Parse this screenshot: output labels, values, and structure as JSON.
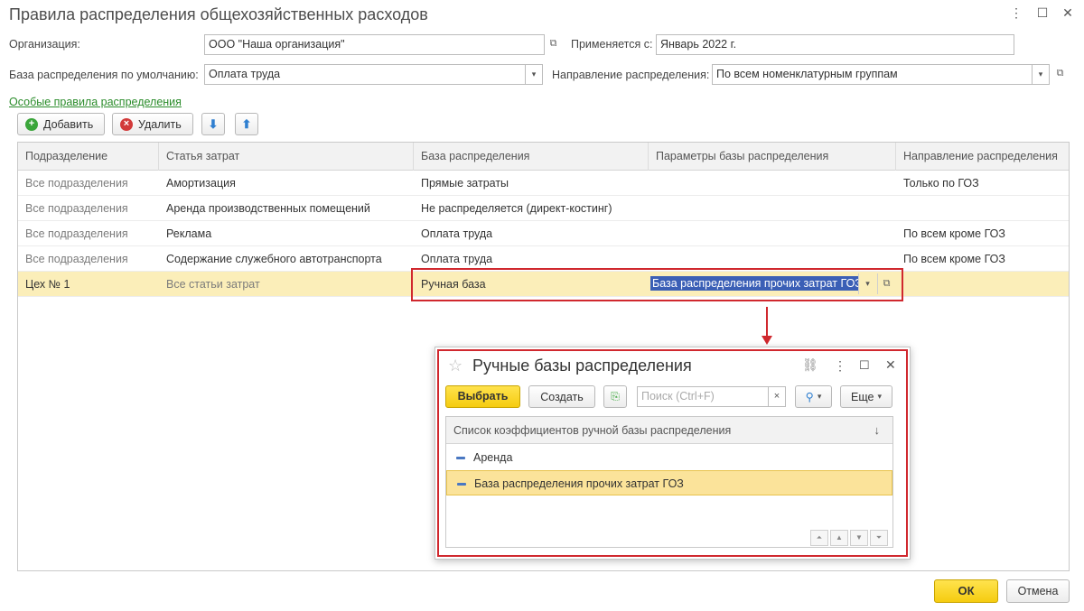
{
  "window": {
    "title": "Правила распределения общехозяйственных расходов",
    "menu_icon": "⋮",
    "maximize_icon": "☐",
    "close_icon": "✕"
  },
  "form": {
    "org_label": "Организация:",
    "org_value": "ООО \"Наша организация\"",
    "applies_label": "Применяется с:",
    "applies_value": "Январь 2022 г.",
    "base_label": "База распределения по умолчанию:",
    "base_value": "Оплата труда",
    "direction_label": "Направление распределения:",
    "direction_value": "По всем номенклатурным группам"
  },
  "special_rules_link": "Особые правила распределения",
  "toolbar": {
    "add_label": "Добавить",
    "delete_label": "Удалить"
  },
  "table": {
    "columns": [
      "Подразделение",
      "Статья затрат",
      "База распределения",
      "Параметры базы распределения",
      "Направление распределения"
    ],
    "rows": [
      [
        "Все подразделения",
        "Амортизация",
        "Прямые затраты",
        "",
        "Только по ГОЗ"
      ],
      [
        "Все подразделения",
        "Аренда производственных помещений",
        "Не распределяется (директ-костинг)",
        "",
        ""
      ],
      [
        "Все подразделения",
        "Реклама",
        "Оплата труда",
        "",
        "По всем кроме ГОЗ"
      ],
      [
        "Все подразделения",
        "Содержание служебного автотранспорта",
        "Оплата труда",
        "",
        "По всем кроме ГОЗ"
      ],
      [
        "Цех № 1",
        "Все статьи затрат",
        "Ручная база",
        "База распределения прочих затрат ГОЗ",
        ""
      ]
    ]
  },
  "popup": {
    "title": "Ручные базы распределения",
    "select_label": "Выбрать",
    "create_label": "Создать",
    "search_placeholder": "Поиск (Ctrl+F)",
    "more_label": "Еще",
    "list_header": "Список коэффициентов ручной базы распределения",
    "items": [
      "Аренда",
      "База распределения прочих затрат ГОЗ"
    ]
  },
  "footer": {
    "ok_label": "ОК",
    "cancel_label": "Отмена"
  },
  "colors": {
    "accent_red": "#d0282e",
    "selected_row": "#fbeeb9",
    "link_green": "#2a8c2a",
    "primary_button": "#f5cc10"
  }
}
